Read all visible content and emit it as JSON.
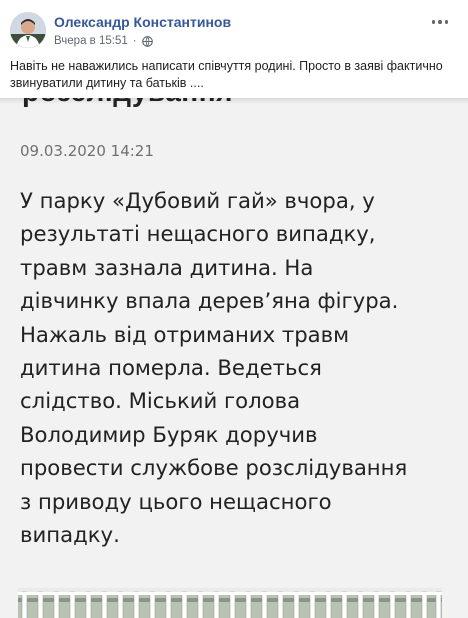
{
  "post": {
    "author": "Олександр Константинов",
    "timestamp": "Вчера в 15:51",
    "caption": "Навіть не наважились написати співчуття родині. Просто в заяві фактично звинуватили дитину та батьків ...."
  },
  "shared_image": {
    "cut_title": "розслідування",
    "date": "09.03.2020 14:21",
    "article_lines": [
      "У парку «Дубовий гай» вчора, у",
      "результаті нещасного випадку,",
      "травм зазнала дитина. На",
      "дівчинку впала дерев’яна фігура.",
      "Нажаль від отриманих травм",
      "дитина померла. Ведеться",
      "слідство. Міський голова",
      "Володимир Буряк доручив",
      "провести службове розслідування",
      "з приводу цього нещасного",
      "випадку."
    ]
  },
  "icons": {
    "privacy": "globe-icon",
    "menu": "more-options-icon"
  },
  "colors": {
    "author_link": "#365899",
    "meta_text": "#616770",
    "body_text": "#1c1e21",
    "article_text": "#222222",
    "article_bg": "#f2f2f2"
  }
}
